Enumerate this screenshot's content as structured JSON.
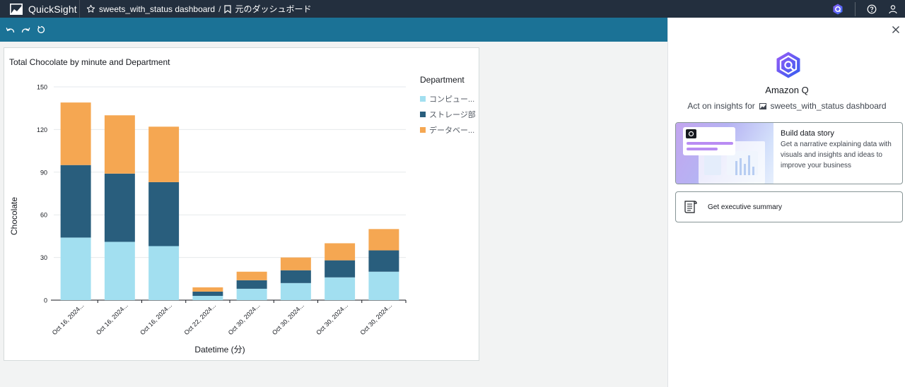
{
  "app": {
    "name": "QuickSight"
  },
  "breadcrumb": {
    "dashboard": "sweets_with_status dashboard",
    "separator": "/",
    "page": "元のダッシュボード"
  },
  "icons": {
    "logo": "quicksight-logo-icon",
    "favorite": "star-icon",
    "bookmark": "bookmark-icon",
    "amazon_q": "amazon-q-icon",
    "help": "help-icon",
    "user": "user-icon",
    "undo": "undo-icon",
    "redo": "redo-icon",
    "reset": "reset-icon",
    "close": "close-icon"
  },
  "colors": {
    "topbar": "#232f3e",
    "toolbar": "#1b7296",
    "computer": "#a2dff0",
    "storage": "#295e7d",
    "data": "#f5a752"
  },
  "chart_data": {
    "type": "bar",
    "stacked": true,
    "title": "Total Chocolate by minute and Department",
    "xlabel": "Datetime (分)",
    "ylabel": "Chocolate",
    "ylim": [
      0,
      150
    ],
    "yticks": [
      0,
      30,
      60,
      90,
      120,
      150
    ],
    "grid": true,
    "legend_position": "right",
    "legend_title": "Department",
    "categories": [
      "Oct 16, 2024...",
      "Oct 16, 2024...",
      "Oct 16, 2024...",
      "Oct 22, 2024...",
      "Oct 30, 2024...",
      "Oct 30, 2024...",
      "Oct 30, 2024...",
      "Oct 30, 2024..."
    ],
    "series": [
      {
        "name": "コンピュー...",
        "color": "#a2dff0",
        "values": [
          44,
          41,
          38,
          3,
          8,
          12,
          16,
          20
        ]
      },
      {
        "name": "ストレージ部",
        "color": "#295e7d",
        "values": [
          51,
          48,
          45,
          3,
          6,
          9,
          12,
          15
        ]
      },
      {
        "name": "データベー...",
        "color": "#f5a752",
        "values": [
          44,
          41,
          39,
          3,
          6,
          9,
          12,
          15
        ]
      }
    ]
  },
  "panel": {
    "title": "Amazon Q",
    "subtitle_prefix": "Act on insights for",
    "subtitle_dashboard": "sweets_with_status dashboard",
    "cards": {
      "story": {
        "title": "Build data story",
        "description": "Get a narrative explaining data with visuals and insights and ideas to improve your business"
      },
      "summary": {
        "title": "Get executive summary"
      }
    }
  }
}
